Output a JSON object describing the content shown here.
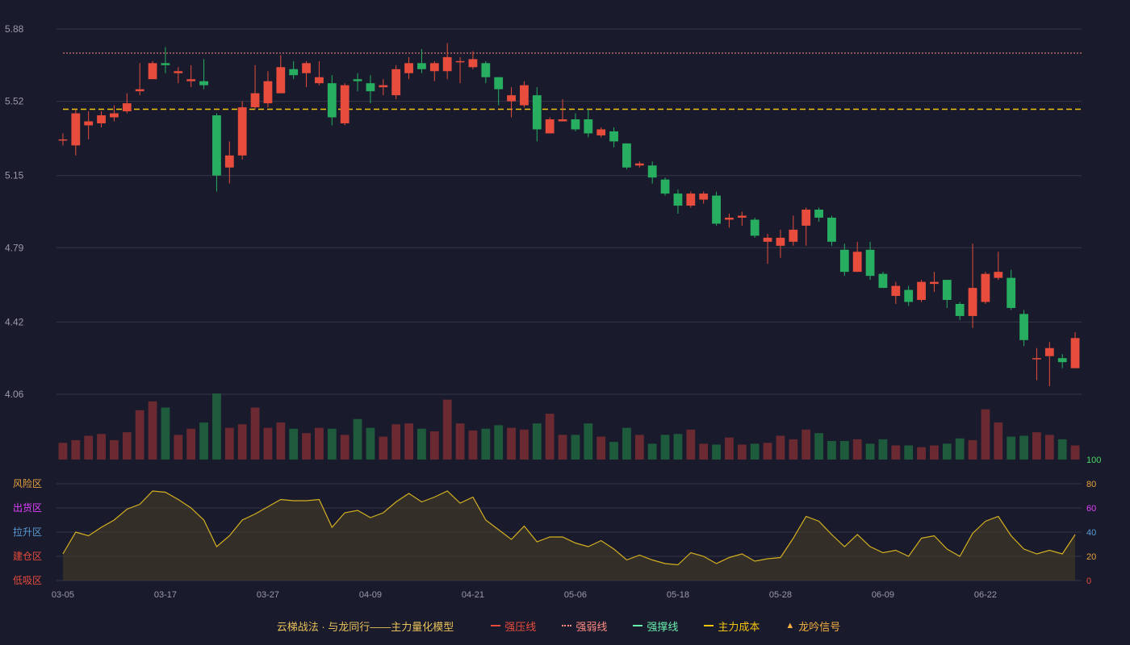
{
  "legend": {
    "title": "云梯战法 · 与龙同行——主力量化模型",
    "items": [
      {
        "label": "强压线",
        "color": "#e74c3c",
        "style": "solid"
      },
      {
        "label": "强弱线",
        "color": "#ff8a80",
        "style": "dotted"
      },
      {
        "label": "强撑线",
        "color": "#69f0ae",
        "style": "solid"
      },
      {
        "label": "主力成本",
        "color": "#f1c40f",
        "style": "dashed"
      },
      {
        "label": "龙吟信号",
        "color": "#f5b041",
        "style": "triangle"
      }
    ]
  },
  "colors": {
    "up": "#e74c3c",
    "down": "#27ae60",
    "vol_up": "#6b2a31",
    "vol_down": "#1e5a3c",
    "indicator": "#d4b020"
  },
  "chart_data": {
    "type": "candlestick",
    "x_ticks": [
      "03-05",
      "03-17",
      "03-27",
      "04-09",
      "04-21",
      "05-06",
      "05-18",
      "05-28",
      "06-09",
      "06-22"
    ],
    "price_ticks": [
      "5.88",
      "5.52",
      "5.15",
      "4.79",
      "4.42",
      "4.06"
    ],
    "price_range": [
      4.06,
      5.88
    ],
    "weak_line": 5.76,
    "cost_line": 5.48,
    "candles": [
      [
        5.33,
        5.33,
        5.36,
        5.3
      ],
      [
        5.3,
        5.46,
        5.48,
        5.25
      ],
      [
        5.4,
        5.42,
        5.47,
        5.33
      ],
      [
        5.41,
        5.45,
        5.47,
        5.39
      ],
      [
        5.44,
        5.46,
        5.5,
        5.42
      ],
      [
        5.47,
        5.51,
        5.56,
        5.46
      ],
      [
        5.57,
        5.58,
        5.71,
        5.55
      ],
      [
        5.63,
        5.71,
        5.72,
        5.63
      ],
      [
        5.71,
        5.7,
        5.79,
        5.66
      ],
      [
        5.66,
        5.67,
        5.69,
        5.61
      ],
      [
        5.62,
        5.63,
        5.7,
        5.59
      ],
      [
        5.62,
        5.6,
        5.73,
        5.58
      ],
      [
        5.45,
        5.15,
        5.46,
        5.07
      ],
      [
        5.19,
        5.25,
        5.32,
        5.11
      ],
      [
        5.25,
        5.49,
        5.52,
        5.23
      ],
      [
        5.49,
        5.56,
        5.7,
        5.48
      ],
      [
        5.51,
        5.62,
        5.67,
        5.49
      ],
      [
        5.56,
        5.69,
        5.75,
        5.56
      ],
      [
        5.68,
        5.65,
        5.72,
        5.63
      ],
      [
        5.66,
        5.71,
        5.72,
        5.59
      ],
      [
        5.61,
        5.64,
        5.72,
        5.6
      ],
      [
        5.61,
        5.44,
        5.65,
        5.4
      ],
      [
        5.41,
        5.6,
        5.61,
        5.4
      ],
      [
        5.63,
        5.62,
        5.66,
        5.57
      ],
      [
        5.61,
        5.57,
        5.65,
        5.51
      ],
      [
        5.59,
        5.6,
        5.63,
        5.55
      ],
      [
        5.55,
        5.68,
        5.7,
        5.53
      ],
      [
        5.66,
        5.71,
        5.74,
        5.63
      ],
      [
        5.71,
        5.68,
        5.78,
        5.66
      ],
      [
        5.67,
        5.71,
        5.72,
        5.62
      ],
      [
        5.67,
        5.74,
        5.81,
        5.63
      ],
      [
        5.72,
        5.72,
        5.74,
        5.61
      ],
      [
        5.69,
        5.73,
        5.77,
        5.68
      ],
      [
        5.71,
        5.64,
        5.72,
        5.61
      ],
      [
        5.64,
        5.58,
        5.64,
        5.5
      ],
      [
        5.52,
        5.55,
        5.59,
        5.44
      ],
      [
        5.5,
        5.6,
        5.62,
        5.49
      ],
      [
        5.55,
        5.38,
        5.59,
        5.32
      ],
      [
        5.36,
        5.43,
        5.44,
        5.36
      ],
      [
        5.42,
        5.43,
        5.53,
        5.42
      ],
      [
        5.43,
        5.38,
        5.46,
        5.37
      ],
      [
        5.43,
        5.36,
        5.48,
        5.34
      ],
      [
        5.35,
        5.38,
        5.39,
        5.34
      ],
      [
        5.37,
        5.32,
        5.39,
        5.29
      ],
      [
        5.31,
        5.19,
        5.31,
        5.18
      ],
      [
        5.2,
        5.21,
        5.22,
        5.19
      ],
      [
        5.2,
        5.14,
        5.22,
        5.11
      ],
      [
        5.13,
        5.06,
        5.14,
        5.05
      ],
      [
        5.06,
        5.0,
        5.08,
        4.96
      ],
      [
        5.0,
        5.06,
        5.07,
        4.99
      ],
      [
        5.03,
        5.06,
        5.07,
        5.01
      ],
      [
        5.05,
        4.91,
        5.07,
        4.9
      ],
      [
        4.93,
        4.94,
        4.96,
        4.89
      ],
      [
        4.94,
        4.95,
        4.97,
        4.9
      ],
      [
        4.93,
        4.85,
        4.94,
        4.84
      ],
      [
        4.82,
        4.84,
        4.86,
        4.71
      ],
      [
        4.8,
        4.84,
        4.88,
        4.74
      ],
      [
        4.82,
        4.88,
        4.95,
        4.8
      ],
      [
        4.9,
        4.98,
        4.99,
        4.8
      ],
      [
        4.98,
        4.94,
        4.99,
        4.92
      ],
      [
        4.94,
        4.82,
        4.95,
        4.8
      ],
      [
        4.78,
        4.67,
        4.81,
        4.65
      ],
      [
        4.67,
        4.77,
        4.82,
        4.67
      ],
      [
        4.78,
        4.65,
        4.82,
        4.63
      ],
      [
        4.66,
        4.59,
        4.67,
        4.59
      ],
      [
        4.55,
        4.6,
        4.62,
        4.51
      ],
      [
        4.58,
        4.52,
        4.6,
        4.5
      ],
      [
        4.53,
        4.62,
        4.63,
        4.52
      ],
      [
        4.61,
        4.62,
        4.67,
        4.57
      ],
      [
        4.63,
        4.53,
        4.63,
        4.49
      ],
      [
        4.51,
        4.45,
        4.52,
        4.43
      ],
      [
        4.45,
        4.59,
        4.81,
        4.39
      ],
      [
        4.52,
        4.66,
        4.67,
        4.51
      ],
      [
        4.64,
        4.67,
        4.77,
        4.63
      ],
      [
        4.64,
        4.49,
        4.68,
        4.48
      ],
      [
        4.46,
        4.33,
        4.48,
        4.3
      ],
      [
        4.24,
        4.24,
        4.29,
        4.13
      ],
      [
        4.25,
        4.29,
        4.32,
        4.1
      ],
      [
        4.24,
        4.22,
        4.26,
        4.19
      ],
      [
        4.19,
        4.34,
        4.37,
        4.19
      ]
    ],
    "volume": [
      19,
      22,
      27,
      29,
      22,
      31,
      56,
      66,
      59,
      28,
      35,
      42,
      75,
      36,
      40,
      59,
      36,
      42,
      35,
      30,
      36,
      35,
      28,
      46,
      36,
      26,
      40,
      41,
      35,
      32,
      68,
      41,
      33,
      35,
      39,
      36,
      34,
      41,
      52,
      28,
      28,
      41,
      26,
      20,
      36,
      28,
      18,
      28,
      29,
      34,
      18,
      17,
      25,
      17,
      18,
      19,
      27,
      23,
      34,
      30,
      21,
      21,
      23,
      18,
      23,
      16,
      16,
      14,
      16,
      18,
      24,
      22,
      57,
      42,
      26,
      27,
      31,
      28,
      23,
      16
    ],
    "indicator": [
      22,
      40,
      37,
      44,
      50,
      59,
      63,
      74,
      73,
      67,
      60,
      50,
      28,
      37,
      50,
      55,
      61,
      67,
      66,
      66,
      67,
      44,
      56,
      58,
      52,
      56,
      65,
      72,
      65,
      69,
      74,
      64,
      69,
      50,
      42,
      34,
      45,
      32,
      36,
      36,
      31,
      28,
      33,
      26,
      17,
      21,
      17,
      14,
      13,
      23,
      20,
      14,
      19,
      22,
      16,
      18,
      19,
      35,
      53,
      49,
      38,
      28,
      38,
      28,
      23,
      25,
      20,
      35,
      37,
      26,
      20,
      39,
      49,
      53,
      37,
      26,
      22,
      25,
      22,
      38
    ],
    "indicator_ticks": [
      "100",
      "80",
      "60",
      "40",
      "20",
      "0"
    ],
    "zones": [
      "风险区",
      "出货区",
      "拉升区",
      "建仓区",
      "低吸区"
    ]
  }
}
